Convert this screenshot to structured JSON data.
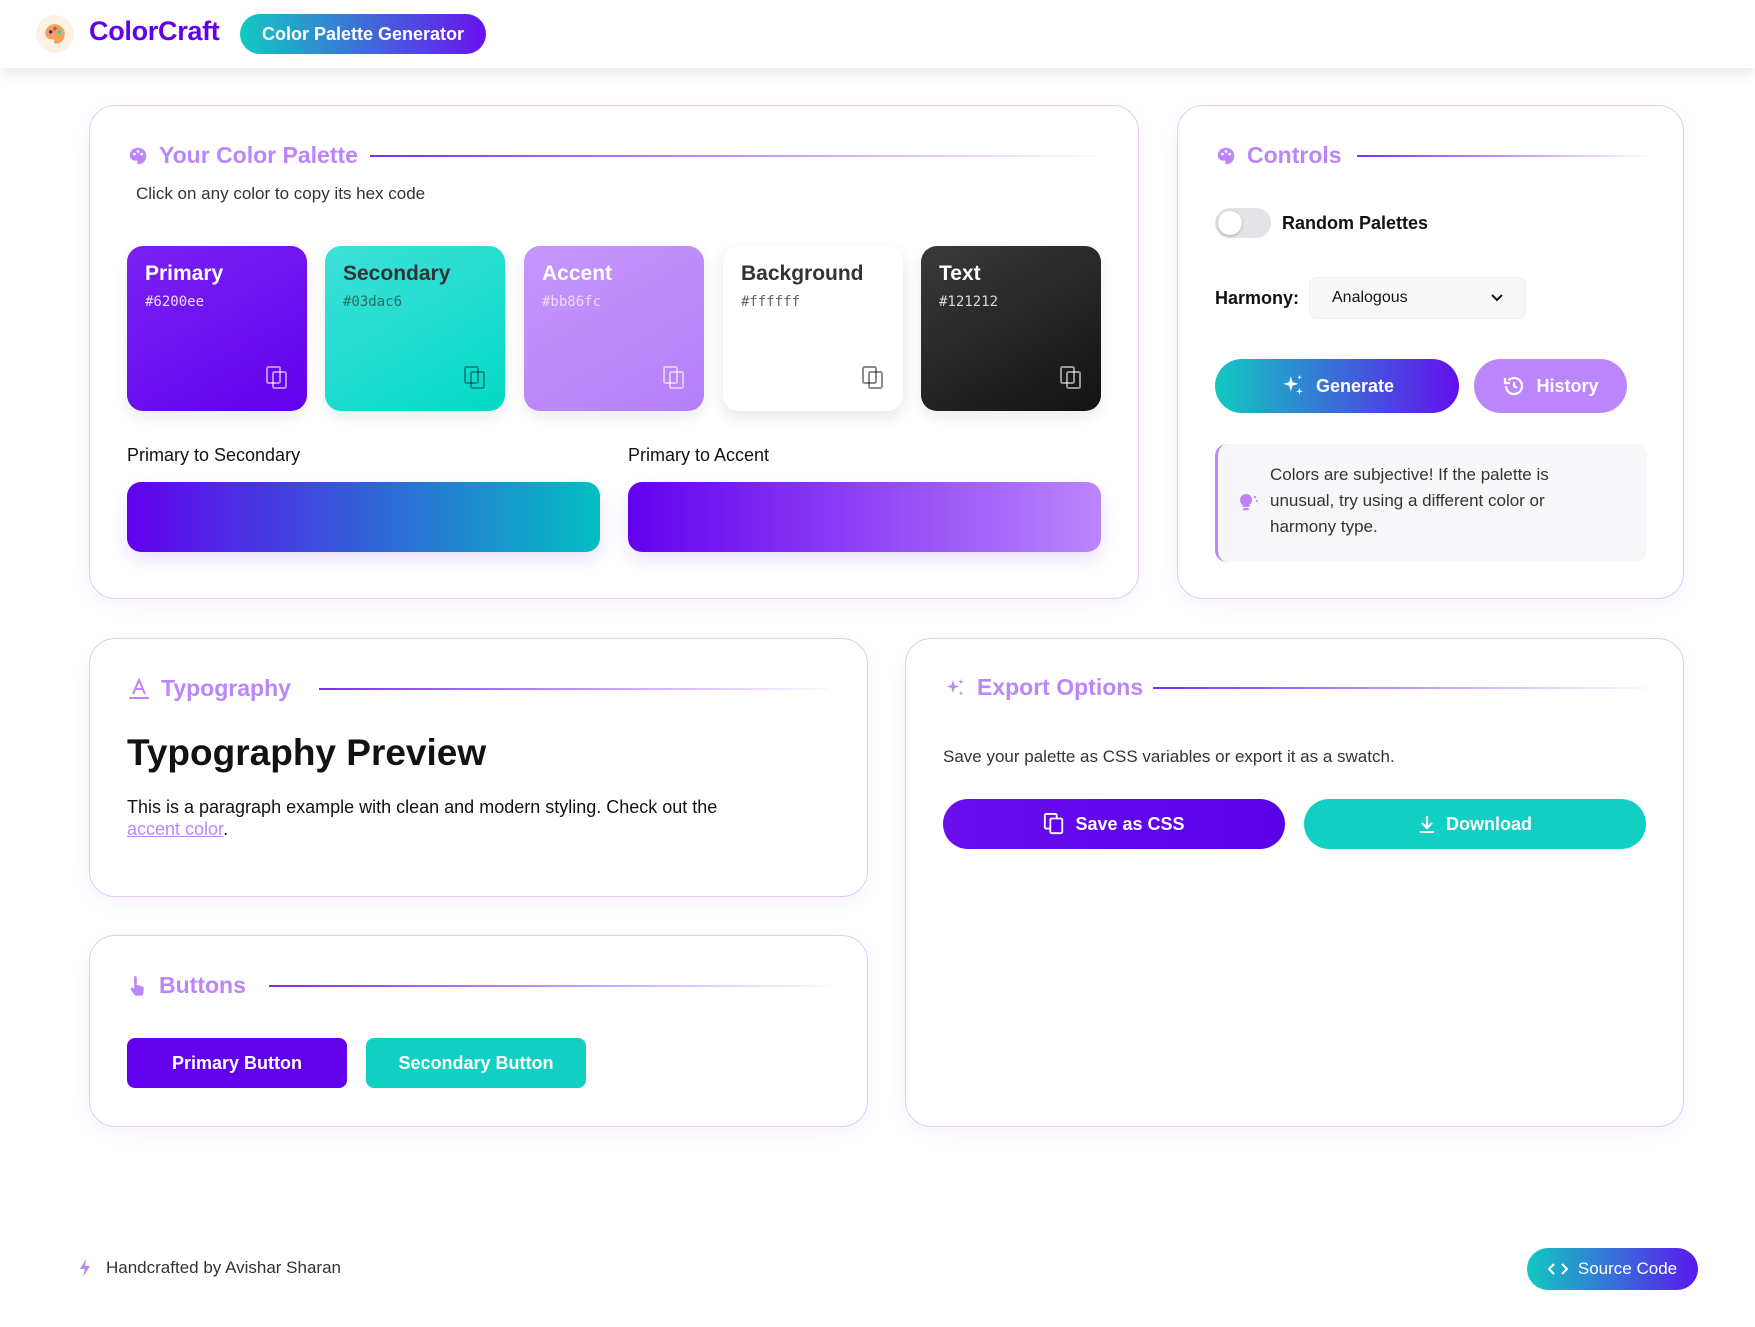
{
  "header": {
    "brand": "ColorCraft",
    "badge": "Color Palette Generator"
  },
  "palette": {
    "title": "Your Color Palette",
    "hint": "Click on any color to copy its hex code",
    "swatches": [
      {
        "name": "Primary",
        "hex": "#6200ee"
      },
      {
        "name": "Secondary",
        "hex": "#03dac6"
      },
      {
        "name": "Accent",
        "hex": "#bb86fc"
      },
      {
        "name": "Background",
        "hex": "#ffffff"
      },
      {
        "name": "Text",
        "hex": "#121212"
      }
    ],
    "gradients": [
      {
        "label": "Primary to Secondary"
      },
      {
        "label": "Primary to Accent"
      }
    ]
  },
  "controls": {
    "title": "Controls",
    "random_label": "Random Palettes",
    "random_enabled": false,
    "harmony_label": "Harmony:",
    "harmony_value": "Analogous",
    "generate_label": "Generate",
    "history_label": "History",
    "tip": "Colors are subjective! If the palette is unusual, try using a different color or harmony type."
  },
  "typography": {
    "title": "Typography",
    "heading": "Typography Preview",
    "paragraph_prefix": "This is a paragraph example with clean and modern styling. Check out the",
    "link_text": "accent color",
    "paragraph_suffix": "."
  },
  "export": {
    "title": "Export Options",
    "description": "Save your palette as CSS variables or export it as a swatch.",
    "save_css_label": "Save as CSS",
    "download_label": "Download"
  },
  "buttons": {
    "title": "Buttons",
    "primary_label": "Primary Button",
    "secondary_label": "Secondary Button"
  },
  "footer": {
    "credit": "Handcrafted by Avishar Sharan",
    "source_label": "Source Code"
  },
  "colors": {
    "primary": "#6200ee",
    "secondary": "#03dac6",
    "accent": "#bb86fc",
    "background": "#ffffff",
    "text": "#121212"
  },
  "icons": {
    "logo": "palette-logo-icon",
    "palette": "palette-icon",
    "typography": "text-icon",
    "buttons": "pointer-icon",
    "export": "sparkle-icon",
    "copy": "copy-icon",
    "generate": "sparkle-icon",
    "history": "history-icon",
    "tip": "lightbulb-icon",
    "download": "download-icon",
    "code": "code-icon",
    "footer": "bolt-icon",
    "select": "chevron-down-icon"
  }
}
